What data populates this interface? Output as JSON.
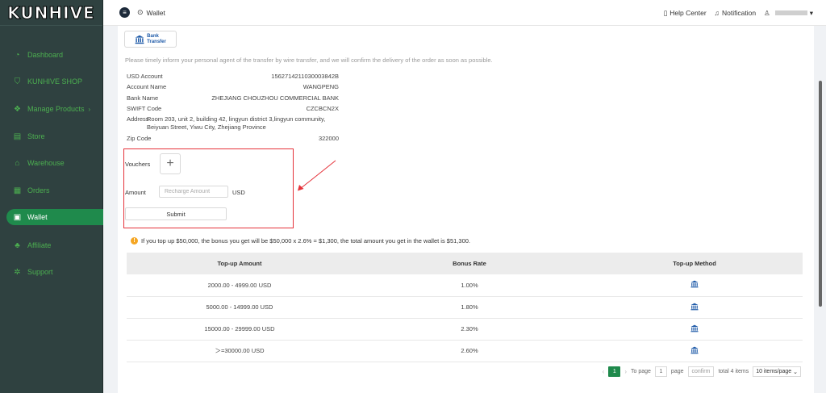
{
  "brand": {
    "logo_text": "KUNHIVE"
  },
  "sidebar": {
    "items": [
      {
        "label": "Dashboard",
        "icon": "dashboard-icon",
        "glyph": "◔"
      },
      {
        "label": "KUNHIVE SHOP",
        "icon": "shop-bag-icon",
        "glyph": "⛉"
      },
      {
        "label": "Manage Products",
        "icon": "box-icon",
        "glyph": "❖",
        "caret": "›"
      },
      {
        "label": "Store",
        "icon": "store-icon",
        "glyph": "▤"
      },
      {
        "label": "Warehouse",
        "icon": "warehouse-icon",
        "glyph": "⌂"
      },
      {
        "label": "Orders",
        "icon": "orders-icon",
        "glyph": "▦"
      },
      {
        "label": "Wallet",
        "icon": "wallet-icon",
        "glyph": "▣",
        "active": true
      },
      {
        "label": "Affiliate",
        "icon": "affiliate-icon",
        "glyph": "♣"
      },
      {
        "label": "Support",
        "icon": "support-icon",
        "glyph": "✲"
      }
    ]
  },
  "header": {
    "breadcrumb": "Wallet",
    "help": "Help Center",
    "notification": "Notification",
    "user_caret": "▾"
  },
  "payment": {
    "method_line1": "Bank",
    "method_line2": "Transfer",
    "notice": "Please timely inform your personal agent of the transfer by wire transfer, and we will confirm the delivery of the order as soon as possible.",
    "fields": [
      {
        "label": "USD Account",
        "value": "1562714211030003842B"
      },
      {
        "label": "Account Name",
        "value": "WANGPENG"
      },
      {
        "label": "Bank Name",
        "value": "ZHEJIANG CHOUZHOU COMMERCIAL BANK"
      },
      {
        "label": "SWIFT Code",
        "value": "CZCBCN2X"
      },
      {
        "label": "Address",
        "value": "Room 203, unit 2, building 42, lingyun district 3,lingyun community, Beiyuan Street, Yiwu City, Zhejiang Province"
      },
      {
        "label": "Zip Code",
        "value": "322000"
      }
    ]
  },
  "form": {
    "vouchers_label": "Vouchers",
    "plus": "+",
    "amount_label": "Amount",
    "amount_placeholder": "Recharge Amount",
    "currency": "USD",
    "submit": "Submit"
  },
  "bonus": {
    "tip": "If you top up $50,000, the bonus you get will be $50,000 x 2.6% = $1,300, the total amount you get in the wallet is $51,300.",
    "columns": [
      "Top-up Amount",
      "Bonus Rate",
      "Top-up Method"
    ],
    "rows": [
      {
        "amount": "2000.00 - 4999.00 USD",
        "rate": "1.00%",
        "method_icon": "bank-icon"
      },
      {
        "amount": "5000.00 - 14999.00 USD",
        "rate": "1.80%",
        "method_icon": "bank-icon"
      },
      {
        "amount": "15000.00 - 29999.00 USD",
        "rate": "2.30%",
        "method_icon": "bank-icon"
      },
      {
        "amount": "＞=30000.00 USD",
        "rate": "2.60%",
        "method_icon": "bank-icon"
      }
    ]
  },
  "pagination": {
    "current": "1",
    "to_page": "To page",
    "page_input": "1",
    "page_word": "page",
    "confirm": "confirm",
    "total": "total 4 items",
    "page_size": "10 items/page"
  },
  "colors": {
    "accent": "#1f8a4c",
    "sidebar_bg": "#2f4140",
    "highlight": "#e5323a",
    "link_blue": "#1e5aa8"
  }
}
